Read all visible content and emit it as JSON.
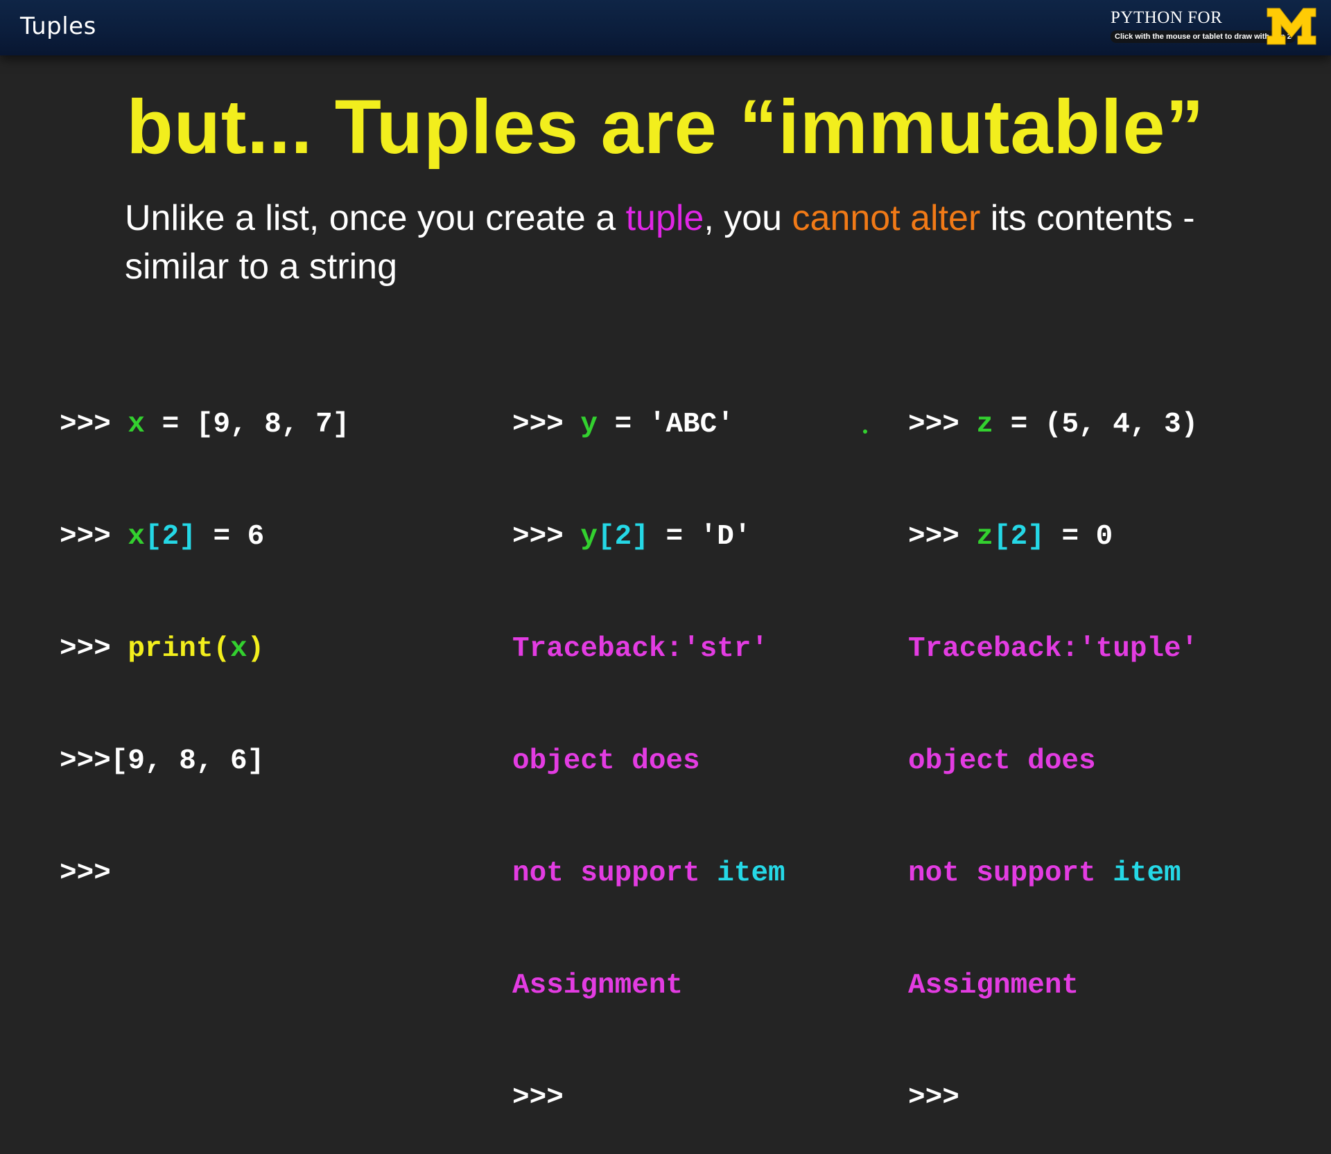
{
  "header": {
    "title": "Tuples",
    "brand_text": "PYTHON FOR",
    "tooltip": "Click with the mouse or tablet to draw with pen 2",
    "logo_letter": "M"
  },
  "slide": {
    "headline": "but... Tuples are “immutable”",
    "subtitle": {
      "part1": "Unlike a list, once you create a ",
      "tuple_word": "tuple",
      "part2": ", you ",
      "cannot_alter": "cannot alter",
      "part3": " its contents - similar to a string"
    },
    "col_list": {
      "l1_prompt": ">>> ",
      "l1_var": "x",
      "l1_rest": " = [9, 8, 7]",
      "l2_prompt": ">>> ",
      "l2_var": "x",
      "l2_idx": "[2]",
      "l2_rest": " = 6",
      "l3_prompt": ">>> ",
      "l3_fn": "print(",
      "l3_var": "x",
      "l3_close": ")",
      "l4": ">>>[9, 8, 6]",
      "l5": ">>>"
    },
    "col_string": {
      "l1_prompt": ">>> ",
      "l1_var": "y",
      "l1_rest": " = 'ABC'",
      "l2_prompt": ">>> ",
      "l2_var": "y",
      "l2_idx": "[2]",
      "l2_rest": " = 'D'",
      "l3": "Traceback:'str'",
      "l4": "object does",
      "l5_a": "not support ",
      "l5_b": "item",
      "l6": "Assignment",
      "l7": ">>>"
    },
    "col_tuple": {
      "l1_prompt": ">>> ",
      "l1_var": "z",
      "l1_rest": " = (5, 4, 3)",
      "l2_prompt": ">>> ",
      "l2_var": "z",
      "l2_idx": "[2]",
      "l2_rest": " = 0",
      "l3": "Traceback:'tuple'",
      "l4": "object does",
      "l5_a": "not support ",
      "l5_b": "item",
      "l6": "Assignment",
      "l7": ">>>"
    }
  },
  "colors": {
    "background": "#242424",
    "headline": "#f2ee1d",
    "pink": "#e026e6",
    "orange": "#f17a17",
    "green": "#33d12f",
    "cyan": "#25d8e6",
    "header_bar": "#0b1d3b"
  }
}
